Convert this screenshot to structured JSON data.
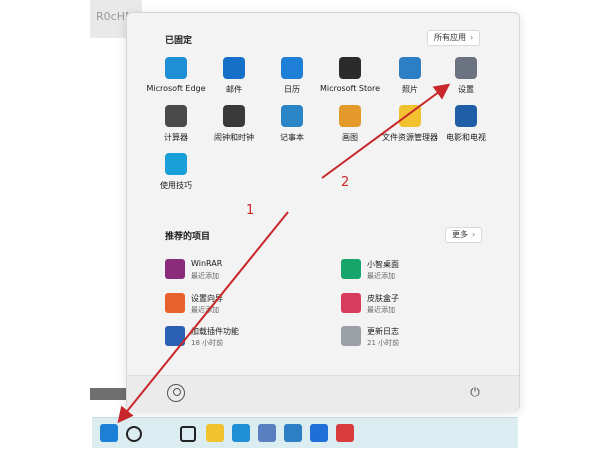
{
  "background": {
    "window_text": "R0cHM"
  },
  "start_menu": {
    "pinned_title": "已固定",
    "all_apps_label": "所有应用",
    "pinned_apps": [
      {
        "label": "Microsoft Edge",
        "icon": "edge-icon",
        "color": "#1f8fd6"
      },
      {
        "label": "邮件",
        "icon": "mail-icon",
        "color": "#1770c7"
      },
      {
        "label": "日历",
        "icon": "calendar-icon",
        "color": "#1f7ed8"
      },
      {
        "label": "Microsoft Store",
        "icon": "store-icon",
        "color": "#2b2b2b"
      },
      {
        "label": "照片",
        "icon": "photos-icon",
        "color": "#2c7fc4"
      },
      {
        "label": "设置",
        "icon": "gear-icon",
        "color": "#6b7280"
      },
      {
        "label": "计算器",
        "icon": "calculator-icon",
        "color": "#4a4a4a"
      },
      {
        "label": "闹钟和时钟",
        "icon": "clock-icon",
        "color": "#3a3a3a"
      },
      {
        "label": "记事本",
        "icon": "notepad-icon",
        "color": "#2a86c7"
      },
      {
        "label": "画图",
        "icon": "paint-icon",
        "color": "#e39a2b"
      },
      {
        "label": "文件资源管理器",
        "icon": "folder-icon",
        "color": "#f2c12e"
      },
      {
        "label": "电影和电视",
        "icon": "movies-icon",
        "color": "#1f5fa8"
      },
      {
        "label": "使用技巧",
        "icon": "tips-icon",
        "color": "#1aa0d8"
      }
    ],
    "recommended_title": "推荐的项目",
    "more_label": "更多",
    "recommended": [
      {
        "name": "WinRAR",
        "time": "最近添加",
        "icon": "winrar-icon",
        "color": "#8a2c7a"
      },
      {
        "name": "小智桌面",
        "time": "最近添加",
        "icon": "desktop-icon",
        "color": "#17a56b"
      },
      {
        "name": "设置向导",
        "time": "最近添加",
        "icon": "wizard-icon",
        "color": "#e8612c"
      },
      {
        "name": "皮肤盒子",
        "time": "最近添加",
        "icon": "skin-icon",
        "color": "#d83c5c"
      },
      {
        "name": "加载插件功能",
        "time": "18 小时前",
        "icon": "word-icon",
        "color": "#2b5fb4"
      },
      {
        "name": "更新日志",
        "time": "21 小时前",
        "icon": "document-icon",
        "color": "#9aa0a6"
      }
    ]
  },
  "taskbar": {
    "icons": [
      {
        "name": "start-icon",
        "color": "#1d7fd6"
      },
      {
        "name": "search-icon",
        "color": "#222222"
      },
      {
        "name": "snap-layout-icon",
        "color": "#222222"
      },
      {
        "name": "file-explorer-icon",
        "color": "#f2c12e"
      },
      {
        "name": "edge-icon",
        "color": "#1f8fd6"
      },
      {
        "name": "app-icon",
        "color": "#5a7fc0"
      },
      {
        "name": "photos-icon",
        "color": "#2c7fc4"
      },
      {
        "name": "defender-icon",
        "color": "#1f6fd6"
      },
      {
        "name": "app-red-icon",
        "color": "#d83c3c"
      }
    ]
  },
  "annotations": {
    "label_1": "1",
    "label_2": "2",
    "color": "#c7262a"
  }
}
